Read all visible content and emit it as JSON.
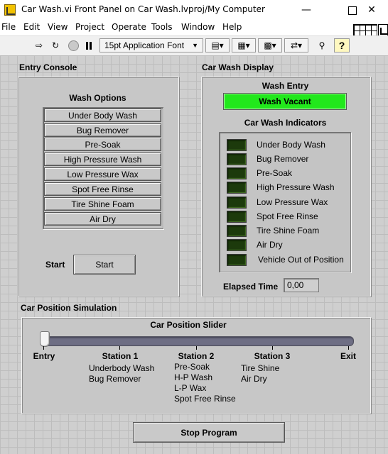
{
  "window": {
    "title": "Car Wash.vi Front Panel on Car Wash.lvproj/My Computer",
    "minimize_icon": "minimize-icon",
    "maximize_icon": "maximize-icon",
    "close_icon": "close-icon"
  },
  "menu": [
    "File",
    "Edit",
    "View",
    "Project",
    "Operate",
    "Tools",
    "Window",
    "Help"
  ],
  "toolbar": {
    "font_select": "15pt Application Font",
    "help_glyph": "?"
  },
  "entry_console": {
    "title": "Entry Console",
    "wash_options_label": "Wash Options",
    "options": [
      "Under Body Wash",
      "Bug Remover",
      "Pre-Soak",
      "High Pressure Wash",
      "Low Pressure Wax",
      "Spot Free Rinse",
      "Tire Shine Foam",
      "Air Dry"
    ],
    "start_label": "Start",
    "start_button": "Start"
  },
  "car_wash_display": {
    "title": "Car Wash Display",
    "wash_entry_label": "Wash Entry",
    "wash_entry_value": "Wash Vacant",
    "indicators_label": "Car Wash Indicators",
    "indicators": [
      "Under Body Wash",
      "Bug Remover",
      "Pre-Soak",
      "High Pressure Wash",
      "Low Pressure Wax",
      "Spot Free Rinse",
      "Tire Shine Foam",
      "Air Dry",
      "Vehicle Out of Position"
    ],
    "elapsed_label": "Elapsed Time",
    "elapsed_value": "0,00"
  },
  "car_position": {
    "title": "Car Position Simulation",
    "slider_label": "Car Position Slider",
    "slider_value_fraction": 0.0,
    "stations": [
      {
        "name": "Entry",
        "tasks": ""
      },
      {
        "name": "Station 1",
        "tasks": "Underbody Wash\nBug Remover"
      },
      {
        "name": "Station 2",
        "tasks": "Pre-Soak\nH-P Wash\nL-P Wax\nSpot Free Rinse"
      },
      {
        "name": "Station 3",
        "tasks": "Tire Shine\nAir Dry"
      },
      {
        "name": "Exit",
        "tasks": ""
      }
    ]
  },
  "stop_button": "Stop  Program",
  "colors": {
    "panel": "#cfcfcf",
    "led_on": "#22e81c",
    "led_off": "#1c3a0c"
  }
}
